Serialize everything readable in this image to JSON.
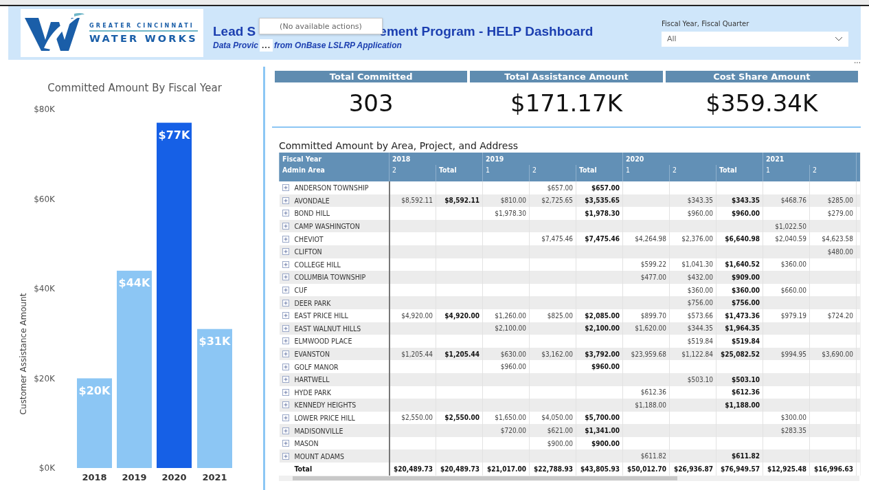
{
  "header": {
    "logo": {
      "line1": "GREATER CINCINNATI",
      "line2": "WATER WORKS"
    },
    "title_start": "Lead S",
    "title_end": "ement Program - HELP Dashboard",
    "subtitle_start": "Data Provic",
    "more_button": "...",
    "subtitle_end": "from OnBase LSLRP Application",
    "tooltip": "(No available actions)",
    "filter": {
      "label": "Fiscal Year, Fiscal Quarter",
      "value": "All"
    }
  },
  "bar_chart": {
    "bars": [
      {
        "color": "#8cc6f4"
      },
      {
        "color": "#8cc6f4"
      },
      {
        "color": "#1660e6"
      },
      {
        "color": "#8cc6f4"
      }
    ],
    "chart_data": {
      "type": "bar",
      "title": "Committed Amount By Fiscal Year",
      "ylabel": "Customer Assistance Amount",
      "categories": [
        "2018",
        "2019",
        "2020",
        "2021"
      ],
      "ylim": [
        0,
        80
      ],
      "yticks": [
        {
          "value": 0,
          "label": "$0K"
        },
        {
          "value": 20,
          "label": "$20K"
        },
        {
          "value": 40,
          "label": "$40K"
        },
        {
          "value": 60,
          "label": "$60K"
        },
        {
          "value": 80,
          "label": "$80K"
        }
      ],
      "values": [
        20,
        44,
        77,
        31
      ],
      "value_labels": [
        "$20K",
        "$44K",
        "$77K",
        "$31K"
      ]
    }
  },
  "visual_menu": "...",
  "kpis": [
    {
      "label": "Total Committed",
      "value": "303"
    },
    {
      "label": "Total Assistance Amount",
      "value": "$171.17K"
    },
    {
      "label": "Cost Share Amount",
      "value": "$359.34K"
    }
  ],
  "table": {
    "title": "Committed Amount by Area, Project, and Address",
    "corner_top": "Fiscal Year",
    "corner_bottom": "Admin Area",
    "years": [
      {
        "label": "2018",
        "columns": [
          {
            "label": "2",
            "kind": "quarter"
          },
          {
            "label": "Total",
            "kind": "total"
          }
        ]
      },
      {
        "label": "2019",
        "columns": [
          {
            "label": "1",
            "kind": "quarter"
          },
          {
            "label": "2",
            "kind": "quarter"
          },
          {
            "label": "Total",
            "kind": "total"
          }
        ]
      },
      {
        "label": "2020",
        "columns": [
          {
            "label": "1",
            "kind": "quarter"
          },
          {
            "label": "2",
            "kind": "quarter"
          },
          {
            "label": "Total",
            "kind": "total"
          }
        ]
      },
      {
        "label": "2021",
        "columns": [
          {
            "label": "1",
            "kind": "quarter"
          },
          {
            "label": "2",
            "kind": "quarter"
          }
        ]
      }
    ],
    "rows": [
      {
        "area": "ANDERSON TOWNSHIP",
        "cells": [
          null,
          null,
          null,
          "$657.00",
          "$657.00",
          null,
          null,
          null,
          null,
          null
        ]
      },
      {
        "area": "AVONDALE",
        "cells": [
          "$8,592.11",
          "$8,592.11",
          "$810.00",
          "$2,725.65",
          "$3,535.65",
          null,
          "$343.35",
          "$343.35",
          "$468.76",
          "$285.00"
        ]
      },
      {
        "area": "BOND HILL",
        "cells": [
          null,
          null,
          "$1,978.30",
          null,
          "$1,978.30",
          null,
          "$960.00",
          "$960.00",
          null,
          "$279.00"
        ]
      },
      {
        "area": "CAMP WASHINGTON",
        "cells": [
          null,
          null,
          null,
          null,
          null,
          null,
          null,
          null,
          "$1,022.50",
          null
        ]
      },
      {
        "area": "CHEVIOT",
        "cells": [
          null,
          null,
          null,
          "$7,475.46",
          "$7,475.46",
          "$4,264.98",
          "$2,376.00",
          "$6,640.98",
          "$2,040.59",
          "$4,623.58"
        ]
      },
      {
        "area": "CLIFTON",
        "cells": [
          null,
          null,
          null,
          null,
          null,
          null,
          null,
          null,
          null,
          "$480.00"
        ]
      },
      {
        "area": "COLLEGE HILL",
        "cells": [
          null,
          null,
          null,
          null,
          null,
          "$599.22",
          "$1,041.30",
          "$1,640.52",
          "$360.00",
          null
        ]
      },
      {
        "area": "COLUMBIA TOWNSHIP",
        "cells": [
          null,
          null,
          null,
          null,
          null,
          "$477.00",
          "$432.00",
          "$909.00",
          null,
          null
        ]
      },
      {
        "area": "CUF",
        "cells": [
          null,
          null,
          null,
          null,
          null,
          null,
          "$360.00",
          "$360.00",
          "$660.00",
          null
        ]
      },
      {
        "area": "DEER PARK",
        "cells": [
          null,
          null,
          null,
          null,
          null,
          null,
          "$756.00",
          "$756.00",
          null,
          null
        ]
      },
      {
        "area": "EAST PRICE HILL",
        "cells": [
          "$4,920.00",
          "$4,920.00",
          "$1,260.00",
          "$825.00",
          "$2,085.00",
          "$899.70",
          "$573.66",
          "$1,473.36",
          "$979.19",
          "$724.20"
        ]
      },
      {
        "area": "EAST WALNUT HILLS",
        "cells": [
          null,
          null,
          "$2,100.00",
          null,
          "$2,100.00",
          "$1,620.00",
          "$344.35",
          "$1,964.35",
          null,
          null
        ]
      },
      {
        "area": "ELMWOOD PLACE",
        "cells": [
          null,
          null,
          null,
          null,
          null,
          null,
          "$519.84",
          "$519.84",
          null,
          null
        ]
      },
      {
        "area": "EVANSTON",
        "cells": [
          "$1,205.44",
          "$1,205.44",
          "$630.00",
          "$3,162.00",
          "$3,792.00",
          "$23,959.68",
          "$1,122.84",
          "$25,082.52",
          "$994.95",
          "$3,690.00"
        ]
      },
      {
        "area": "GOLF MANOR",
        "cells": [
          null,
          null,
          "$960.00",
          null,
          "$960.00",
          null,
          null,
          null,
          null,
          null
        ]
      },
      {
        "area": "HARTWELL",
        "cells": [
          null,
          null,
          null,
          null,
          null,
          null,
          "$503.10",
          "$503.10",
          null,
          null
        ]
      },
      {
        "area": "HYDE PARK",
        "cells": [
          null,
          null,
          null,
          null,
          null,
          "$612.36",
          null,
          "$612.36",
          null,
          null
        ]
      },
      {
        "area": "KENNEDY HEIGHTS",
        "cells": [
          null,
          null,
          null,
          null,
          null,
          "$1,188.00",
          null,
          "$1,188.00",
          null,
          null
        ]
      },
      {
        "area": "LOWER PRICE HILL",
        "cells": [
          "$2,550.00",
          "$2,550.00",
          "$1,650.00",
          "$4,050.00",
          "$5,700.00",
          null,
          null,
          null,
          "$300.00",
          null
        ]
      },
      {
        "area": "MADISONVILLE",
        "cells": [
          null,
          null,
          "$720.00",
          "$621.00",
          "$1,341.00",
          null,
          null,
          null,
          "$283.35",
          null
        ]
      },
      {
        "area": "MASON",
        "cells": [
          null,
          null,
          null,
          "$900.00",
          "$900.00",
          null,
          null,
          null,
          null,
          null
        ]
      },
      {
        "area": "MOUNT ADAMS",
        "cells": [
          null,
          null,
          null,
          null,
          null,
          "$611.82",
          null,
          "$611.82",
          null,
          null
        ]
      }
    ],
    "total": {
      "label": "Total",
      "cells": [
        "$20,489.73",
        "$20,489.73",
        "$21,017.00",
        "$22,788.93",
        "$43,805.93",
        "$50,012.70",
        "$26,936.87",
        "$76,949.57",
        "$12,925.48",
        "$16,996.63"
      ]
    }
  }
}
